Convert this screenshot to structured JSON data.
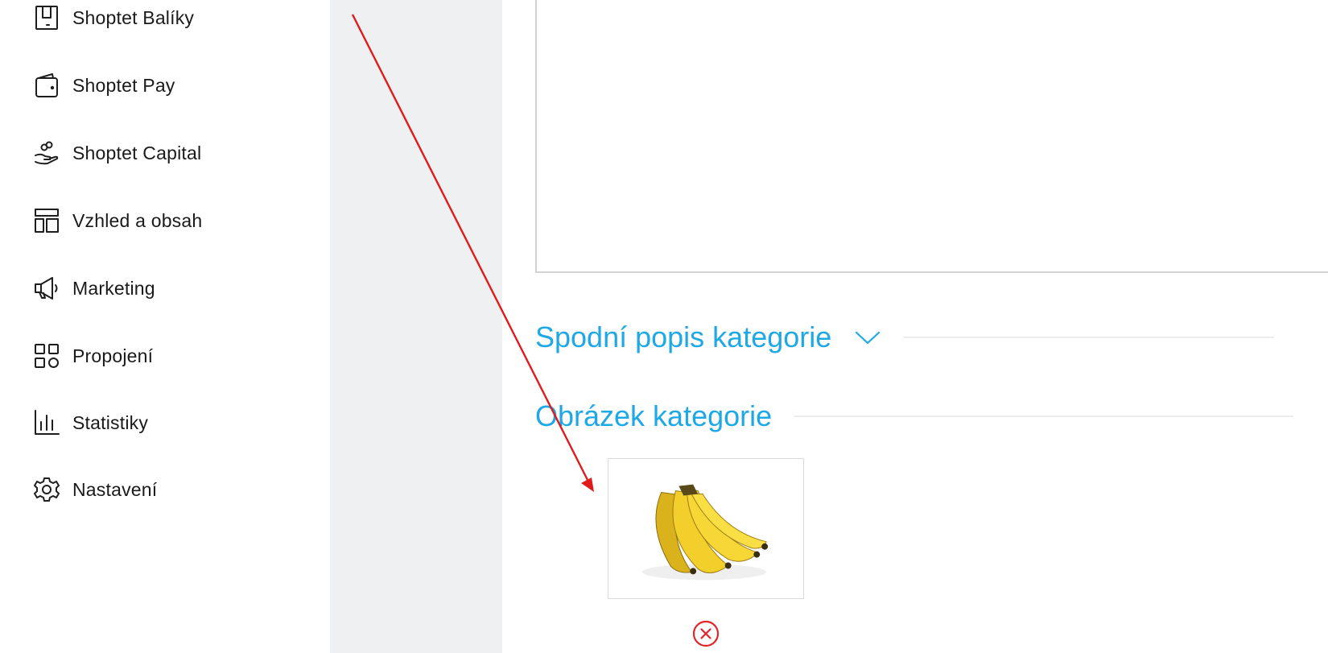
{
  "sidebar": {
    "items": [
      {
        "label": "Shoptet Balíky",
        "icon": "package-icon"
      },
      {
        "label": "Shoptet Pay",
        "icon": "wallet-icon"
      },
      {
        "label": "Shoptet Capital",
        "icon": "hand-coins-icon"
      },
      {
        "label": "Vzhled a obsah",
        "icon": "layout-icon"
      },
      {
        "label": "Marketing",
        "icon": "megaphone-icon"
      },
      {
        "label": "Propojení",
        "icon": "apps-grid-icon"
      },
      {
        "label": "Statistiky",
        "icon": "bar-chart-icon"
      },
      {
        "label": "Nastavení",
        "icon": "gear-icon"
      }
    ]
  },
  "main": {
    "bottom_description": {
      "title": "Spodní popis kategorie",
      "icon": "chevron-down-icon"
    },
    "category_image": {
      "title": "Obrázek kategorie",
      "image": "banana-bunch",
      "remove_icon": "remove-circle-icon"
    }
  },
  "colors": {
    "accent": "#1fa8e6",
    "danger": "#e0262b",
    "annotation_arrow": "#e01b1b",
    "gap_background": "#eff0f2"
  }
}
